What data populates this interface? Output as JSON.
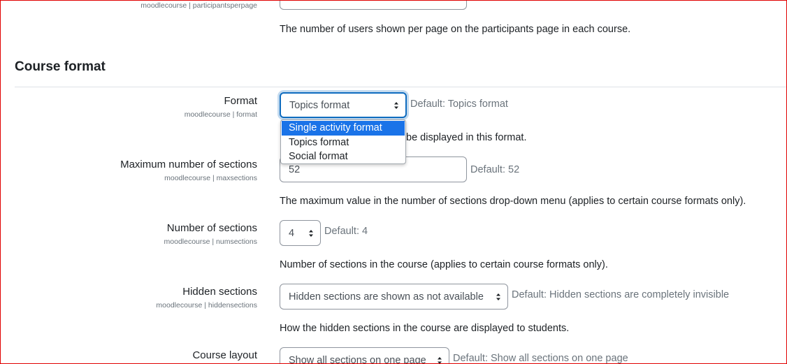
{
  "top": {
    "participants_sub": "moodlecourse | participantsperpage",
    "participants_desc": "The number of users shown per page on the participants page in each course."
  },
  "section": {
    "title": "Course format"
  },
  "format": {
    "label": "Format",
    "sub": "moodlecourse | format",
    "value": "Topics format",
    "default": "Default: Topics format",
    "desc_visible": "be displayed in this format.",
    "options": [
      "Single activity format",
      "Topics format",
      "Social format"
    ],
    "highlighted": "Single activity format"
  },
  "maxsections": {
    "label": "Maximum number of sections",
    "sub": "moodlecourse | maxsections",
    "value": "52",
    "default": "Default: 52",
    "desc": "The maximum value in the number of sections drop-down menu (applies to certain course formats only)."
  },
  "numsections": {
    "label": "Number of sections",
    "sub": "moodlecourse | numsections",
    "value": "4",
    "default": "Default: 4",
    "desc": "Number of sections in the course (applies to certain course formats only)."
  },
  "hiddensections": {
    "label": "Hidden sections",
    "sub": "moodlecourse | hiddensections",
    "value": "Hidden sections are shown as not available",
    "default": "Default: Hidden sections are completely invisible",
    "desc": "How the hidden sections in the course are displayed to students."
  },
  "courselayout": {
    "label": "Course layout",
    "value": "Show all sections on one page",
    "default": "Default: Show all sections on one page"
  },
  "colors": {
    "focus": "#0f6cbf",
    "highlight": "#1a73e8",
    "frame": "#e10000"
  }
}
